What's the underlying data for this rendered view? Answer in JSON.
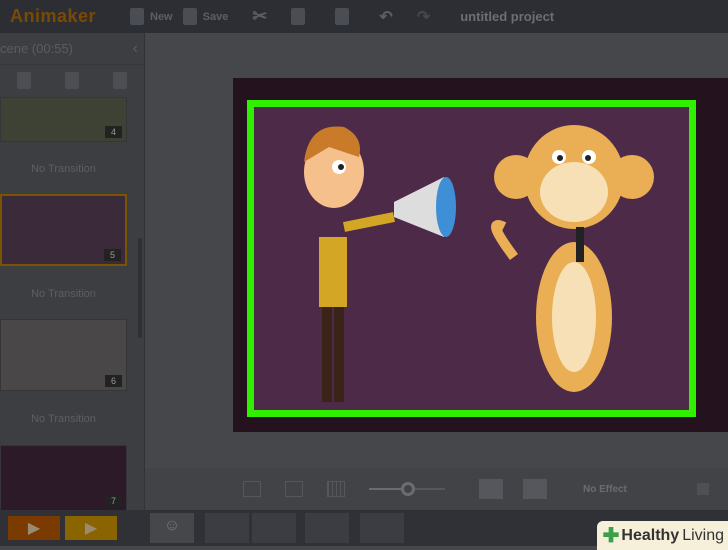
{
  "app": {
    "logo": "Animaker",
    "project_title": "untitled project"
  },
  "toolbar": {
    "new_label": "New",
    "save_label": "Save"
  },
  "sidebar": {
    "header": "cene  (00:55)",
    "scenes": [
      {
        "number": "4"
      },
      {
        "number": "5",
        "selected": true
      },
      {
        "number": "6"
      },
      {
        "number": "7"
      }
    ],
    "transitions": [
      "No Transition",
      "No Transition",
      "No Transition"
    ]
  },
  "controls": {
    "effect_label": "No Effect",
    "zoom_level": 0.45
  },
  "watermark": {
    "brand": "Healthy",
    "suffix": "Living"
  },
  "colors": {
    "highlight": "#2ef000",
    "stage": "#4d2a47",
    "accent": "#c48a00"
  }
}
